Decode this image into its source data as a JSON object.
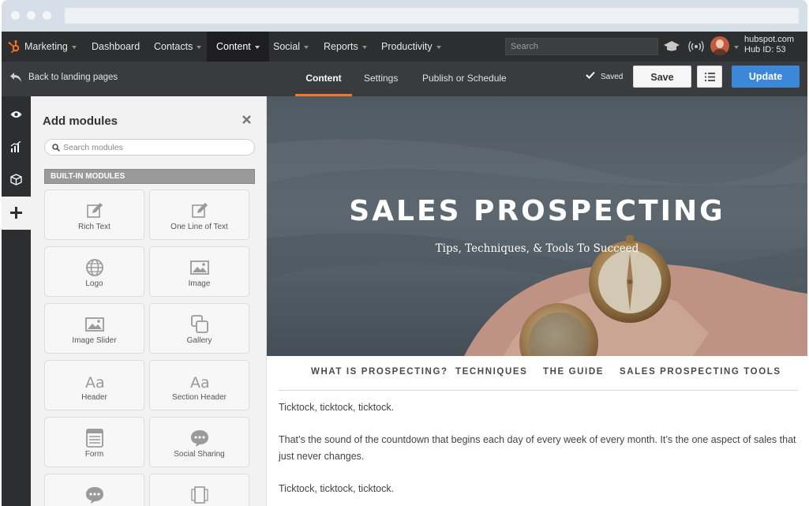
{
  "nav": {
    "brand": "Marketing",
    "items": [
      "Dashboard",
      "Contacts",
      "Content",
      "Social",
      "Reports",
      "Productivity"
    ],
    "search_placeholder": "Search",
    "account": "hubspot.com",
    "hub_id": "Hub ID: 53"
  },
  "editor_bar": {
    "back": "Back to landing pages",
    "tabs": [
      "Content",
      "Settings",
      "Publish or Schedule"
    ],
    "status": "Saved",
    "save": "Save",
    "update": "Update"
  },
  "panel": {
    "title": "Add modules",
    "search_placeholder": "Search modules",
    "section": "BUILT-IN MODULES",
    "modules": [
      {
        "label": "Rich Text",
        "icon": "edit-icon"
      },
      {
        "label": "One Line of Text",
        "icon": "edit-icon"
      },
      {
        "label": "Logo",
        "icon": "globe-icon"
      },
      {
        "label": "Image",
        "icon": "image-icon"
      },
      {
        "label": "Image Slider",
        "icon": "image-icon"
      },
      {
        "label": "Gallery",
        "icon": "gallery-icon"
      },
      {
        "label": "Header",
        "icon": "text-icon"
      },
      {
        "label": "Section Header",
        "icon": "text-icon"
      },
      {
        "label": "Form",
        "icon": "form-icon"
      },
      {
        "label": "Social Sharing",
        "icon": "chat-icon"
      }
    ]
  },
  "page": {
    "hero_title": "SALES PROSPECTING",
    "hero_subtitle": "Tips, Techniques, & Tools To Succeed",
    "topnav": [
      "WHAT IS PROSPECTING?",
      "TECHNIQUES",
      "THE GUIDE",
      "SALES PROSPECTING TOOLS"
    ],
    "paragraphs": [
      "Ticktock, ticktock, ticktock.",
      "That’s the sound of the countdown that begins each day of every week of every month. It’s the one aspect of sales that just never changes.",
      "Ticktock, ticktock, ticktock."
    ]
  },
  "colors": {
    "accent_orange": "#f57722",
    "update_blue": "#3b87d9",
    "nav_dark": "#2d2e30"
  }
}
